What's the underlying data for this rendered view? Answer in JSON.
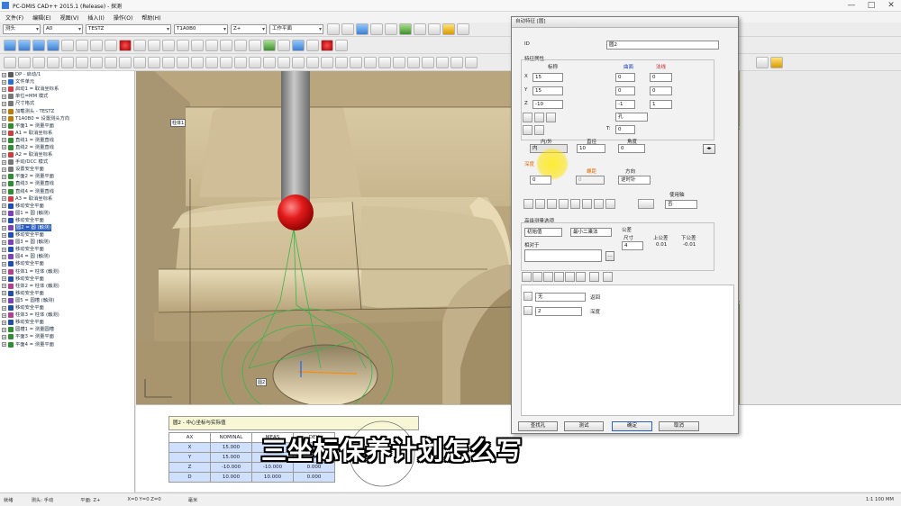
{
  "window": {
    "title": "PC-DMIS CAD++ 2015.1 (Release) - 探测",
    "minimize": "—",
    "maximize": "□",
    "close": "✕"
  },
  "menu": [
    "文件(F)",
    "编辑(E)",
    "视图(V)",
    "插入(I)",
    "操作(O)",
    "帮助(H)"
  ],
  "toolbar": {
    "probe_label": "测头",
    "tip_value": "A0",
    "combo_probe": "TESTZ",
    "combo_tip": "T1A0B0",
    "combo_plane": "工作平面",
    "combo_z": "Z+"
  },
  "tree": {
    "items": [
      {
        "text": "DP - 启动/1",
        "kind": "root"
      },
      {
        "text": "文件单元",
        "kind": "doc"
      },
      {
        "text": "启动1 = 取消坐标系",
        "kind": "align"
      },
      {
        "text": "单位=MM  模式",
        "kind": "set"
      },
      {
        "text": "尺寸格式",
        "kind": "set"
      },
      {
        "text": "加载测头 - TESTZ",
        "kind": "probe"
      },
      {
        "text": "T1A0B0 = 设置测头方向",
        "kind": "probe"
      },
      {
        "text": "平面1 = 测量平面",
        "kind": "feat"
      },
      {
        "text": "A1 = 取消坐标系",
        "kind": "align"
      },
      {
        "text": "直线1 = 测量直线",
        "kind": "feat"
      },
      {
        "text": "直线2 = 测量直线",
        "kind": "feat"
      },
      {
        "text": "A2 = 取消坐标系",
        "kind": "align"
      },
      {
        "text": "手动/DCC 模式",
        "kind": "set"
      },
      {
        "text": "设置安全平面",
        "kind": "set"
      },
      {
        "text": "平面2 = 测量平面",
        "kind": "feat"
      },
      {
        "text": "直线3 = 测量直线",
        "kind": "feat"
      },
      {
        "text": "直线4 = 测量直线",
        "kind": "feat"
      },
      {
        "text": "A3 = 取消坐标系",
        "kind": "align"
      },
      {
        "text": "移动安全平面",
        "kind": "move"
      },
      {
        "text": "圆1 = 圆 (触测)",
        "kind": "circ"
      },
      {
        "text": "移动安全平面",
        "kind": "move"
      },
      {
        "text": "圆2 = 圆 (触测)",
        "kind": "circ",
        "selected": true
      },
      {
        "text": "移动安全平面",
        "kind": "move"
      },
      {
        "text": "圆3 = 圆 (触测)",
        "kind": "circ"
      },
      {
        "text": "移动安全平面",
        "kind": "move"
      },
      {
        "text": "圆4 = 圆 (触测)",
        "kind": "circ"
      },
      {
        "text": "移动安全平面",
        "kind": "move"
      },
      {
        "text": "柱体1 = 柱体 (触测)",
        "kind": "cyl"
      },
      {
        "text": "移动安全平面",
        "kind": "move"
      },
      {
        "text": "柱体2 = 柱体 (触测)",
        "kind": "cyl"
      },
      {
        "text": "移动安全平面",
        "kind": "move"
      },
      {
        "text": "圆5 = 圆槽 (触测)",
        "kind": "circ"
      },
      {
        "text": "移动安全平面",
        "kind": "move"
      },
      {
        "text": "柱体3 = 柱体 (触测)",
        "kind": "cyl"
      },
      {
        "text": "移动安全平面",
        "kind": "move"
      },
      {
        "text": "圆槽1 = 测量圆槽",
        "kind": "feat"
      },
      {
        "text": "平面3 = 测量平面",
        "kind": "feat"
      },
      {
        "text": "平面4 = 测量平面",
        "kind": "feat"
      }
    ]
  },
  "viewport": {
    "label_top": "柱体1",
    "label_circle": "圆2"
  },
  "dialog": {
    "caption": "自动特征 [圆]",
    "id_label": "ID",
    "id_value": "圆2",
    "group_props": "特征属性",
    "col_nominal": "标称",
    "col_center": "曲面",
    "col_vector": "法线",
    "x_label": "X",
    "y_label": "Y",
    "z_label": "Z",
    "x_val": "15",
    "y_val": "15",
    "z_val": "-10",
    "ix_val": "0",
    "iy_val": "0",
    "iz_val": "-1",
    "jx_val": "0",
    "jy_val": "0",
    "jz_val": "1",
    "mode_val": "孔",
    "t_label": "T:",
    "t_val": "0",
    "inout_label": "内/外",
    "inout_val": "内",
    "diam_label": "直径",
    "diam_val": "10",
    "angle_label": "角度",
    "angle_val": "0",
    "depth_label": "深度",
    "depth_val": "0",
    "pitch_label": "螺距",
    "pitch_val": "0",
    "dir_label": "方向",
    "dir_val": "逆时针",
    "usage_label": "使用轴",
    "usage_val": "否",
    "group_adv": "高级测量选项",
    "strategy_val": "初始值",
    "fit_val": "最小二乘法",
    "relative_label": "相对于",
    "tolerance_label": "公差",
    "dim_label": "尺寸",
    "upper_label": "上公差",
    "lower_label": "下公差",
    "upper_val": "0.01",
    "lower_val": "-0.01",
    "hits_label": "测点",
    "hits_val": "4",
    "samp_val": "无",
    "samp_text": "返回",
    "depth2_val": "2",
    "depth2_text": "深度",
    "btn_find": "查找孔",
    "btn_test": "测试",
    "btn_ok": "确定",
    "btn_cancel": "取消"
  },
  "report": {
    "header": "圆2 - 中心坐标与实际值",
    "columns": [
      "AX",
      "NOMINAL",
      "MEAS",
      "DEV"
    ],
    "rows": [
      [
        "X",
        "15.000",
        "",
        ""
      ],
      [
        "Y",
        "15.000",
        "",
        ""
      ],
      [
        "Z",
        "-10.000",
        "-10.000",
        "0.000"
      ],
      [
        "D",
        "10.000",
        "10.000",
        "0.000"
      ]
    ]
  },
  "status": {
    "ready": "就绪",
    "mode": "测头: 手动",
    "plane": "平面: Z+",
    "coord": "X=0 Y=0 Z=0",
    "unit": "毫米",
    "right": "1:1  100  MM"
  },
  "caption": "三坐标保养计划怎么写",
  "colors": {
    "accent": "#2b5fbf",
    "part": "#bfad8a",
    "probe_ball": "#e02020"
  }
}
